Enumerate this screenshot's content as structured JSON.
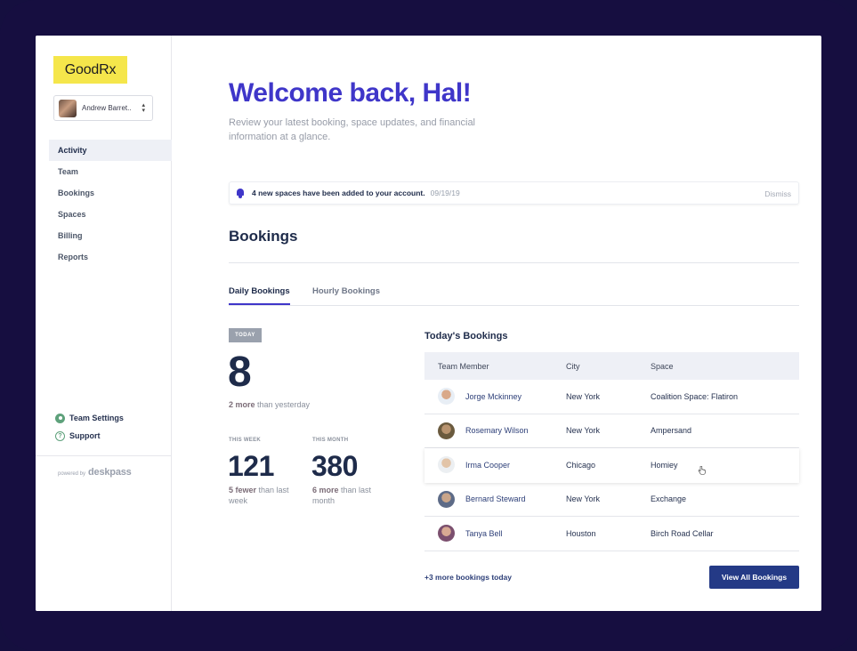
{
  "brand": {
    "logo_text": "GoodRx"
  },
  "user": {
    "name": "Andrew Barret.."
  },
  "nav": {
    "items": [
      {
        "label": "Activity",
        "active": true
      },
      {
        "label": "Team"
      },
      {
        "label": "Bookings"
      },
      {
        "label": "Spaces"
      },
      {
        "label": "Billing"
      },
      {
        "label": "Reports"
      }
    ]
  },
  "sidebar_bottom": {
    "team_settings": "Team Settings",
    "support": "Support",
    "powered_by": "powered by",
    "powered_brand": "deskpass"
  },
  "header": {
    "welcome": "Welcome back, Hal!",
    "subtitle": "Review your latest booking, space updates, and financial information at a glance."
  },
  "notice": {
    "text": "4 new spaces have been added to your account.",
    "date": "09/19/19",
    "dismiss": "Dismiss"
  },
  "bookings": {
    "title": "Bookings",
    "tabs": [
      "Daily Bookings",
      "Hourly Bookings"
    ],
    "today": {
      "badge": "TODAY",
      "value": "8",
      "delta_strong": "2 more",
      "delta_rest": " than yesterday"
    },
    "this_week": {
      "label": "THIS WEEK",
      "value": "121",
      "delta_strong": "5 fewer",
      "delta_rest": " than last week"
    },
    "this_month": {
      "label": "THIS MONTH",
      "value": "380",
      "delta_strong": "6 more",
      "delta_rest": " than last month"
    },
    "table": {
      "title": "Today's Bookings",
      "columns": [
        "Team Member",
        "City",
        "Space"
      ],
      "rows": [
        {
          "member": "Jorge Mckinney",
          "city": "New York",
          "space": "Coalition Space: Flatiron"
        },
        {
          "member": "Rosemary Wilson",
          "city": "New York",
          "space": "Ampersand"
        },
        {
          "member": "Irma Cooper",
          "city": "Chicago",
          "space": "Homiey"
        },
        {
          "member": "Bernard Steward",
          "city": "New York",
          "space": "Exchange"
        },
        {
          "member": "Tanya Bell",
          "city": "Houston",
          "space": "Birch Road Cellar"
        }
      ]
    },
    "more_link": "+3 more bookings today",
    "view_all": "View All Bookings"
  },
  "colors": {
    "accent": "#3f36c9",
    "navy": "#1e2b4a",
    "button": "#243a86",
    "logo_bg": "#f5e64b",
    "frame": "#160e40"
  }
}
